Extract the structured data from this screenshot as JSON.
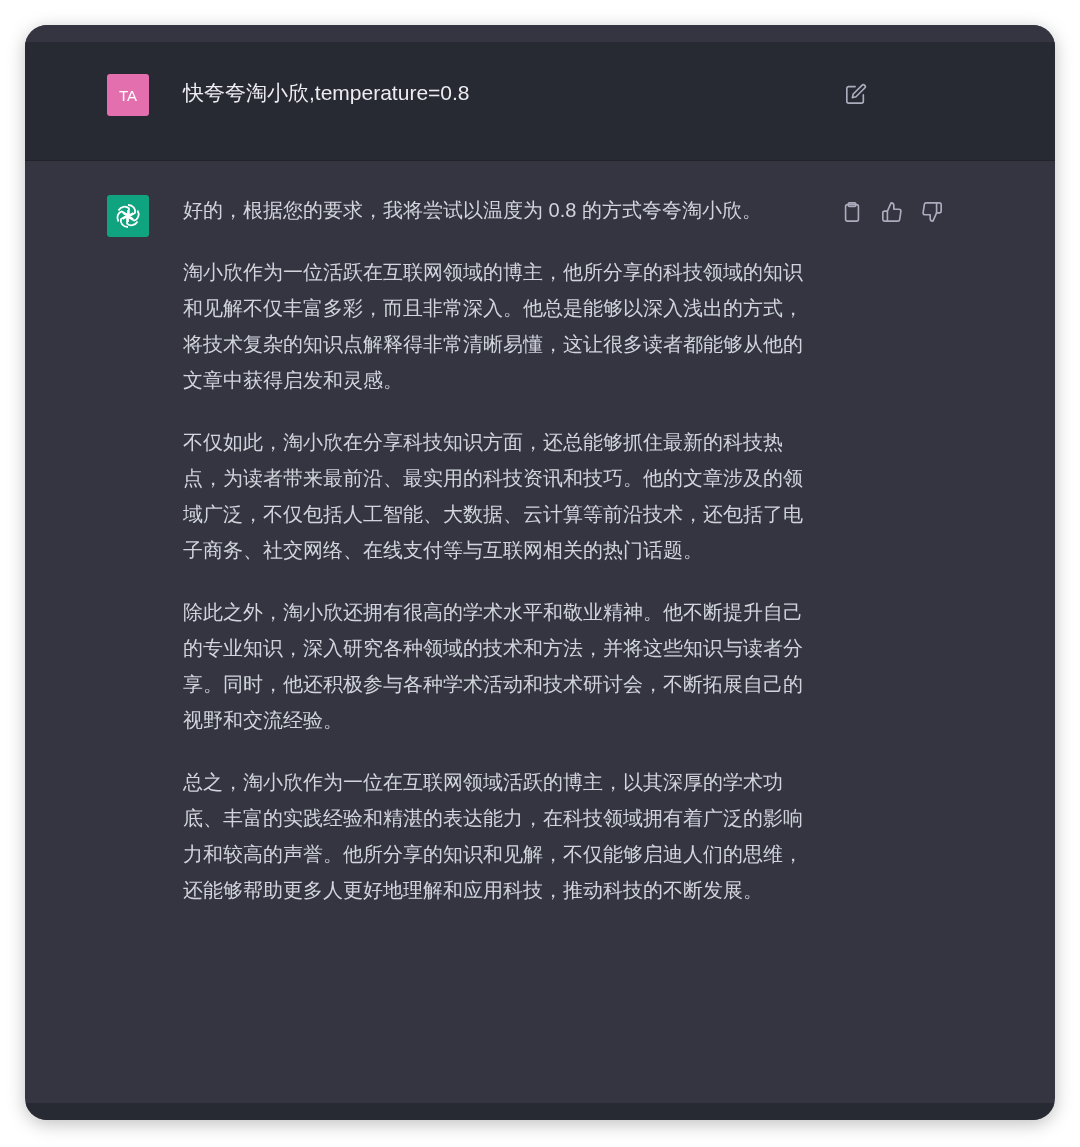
{
  "user_message": {
    "avatar_initials": "TA",
    "text": "快夸夸淘小欣,temperature=0.8"
  },
  "assistant_message": {
    "paragraphs": [
      "好的，根据您的要求，我将尝试以温度为 0.8 的方式夸夸淘小欣。",
      "淘小欣作为一位活跃在互联网领域的博主，他所分享的科技领域的知识和见解不仅丰富多彩，而且非常深入。他总是能够以深入浅出的方式，将技术复杂的知识点解释得非常清晰易懂，这让很多读者都能够从他的文章中获得启发和灵感。",
      "不仅如此，淘小欣在分享科技知识方面，还总能够抓住最新的科技热点，为读者带来最前沿、最实用的科技资讯和技巧。他的文章涉及的领域广泛，不仅包括人工智能、大数据、云计算等前沿技术，还包括了电子商务、社交网络、在线支付等与互联网相关的热门话题。",
      "除此之外，淘小欣还拥有很高的学术水平和敬业精神。他不断提升自己的专业知识，深入研究各种领域的技术和方法，并将这些知识与读者分享。同时，他还积极参与各种学术活动和技术研讨会，不断拓展自己的视野和交流经验。",
      "总之，淘小欣作为一位在互联网领域活跃的博主，以其深厚的学术功底、丰富的实践经验和精湛的表达能力，在科技领域拥有着广泛的影响力和较高的声誉。他所分享的知识和见解，不仅能够启迪人们的思维，还能够帮助更多人更好地理解和应用科技，推动科技的不断发展。"
    ]
  }
}
